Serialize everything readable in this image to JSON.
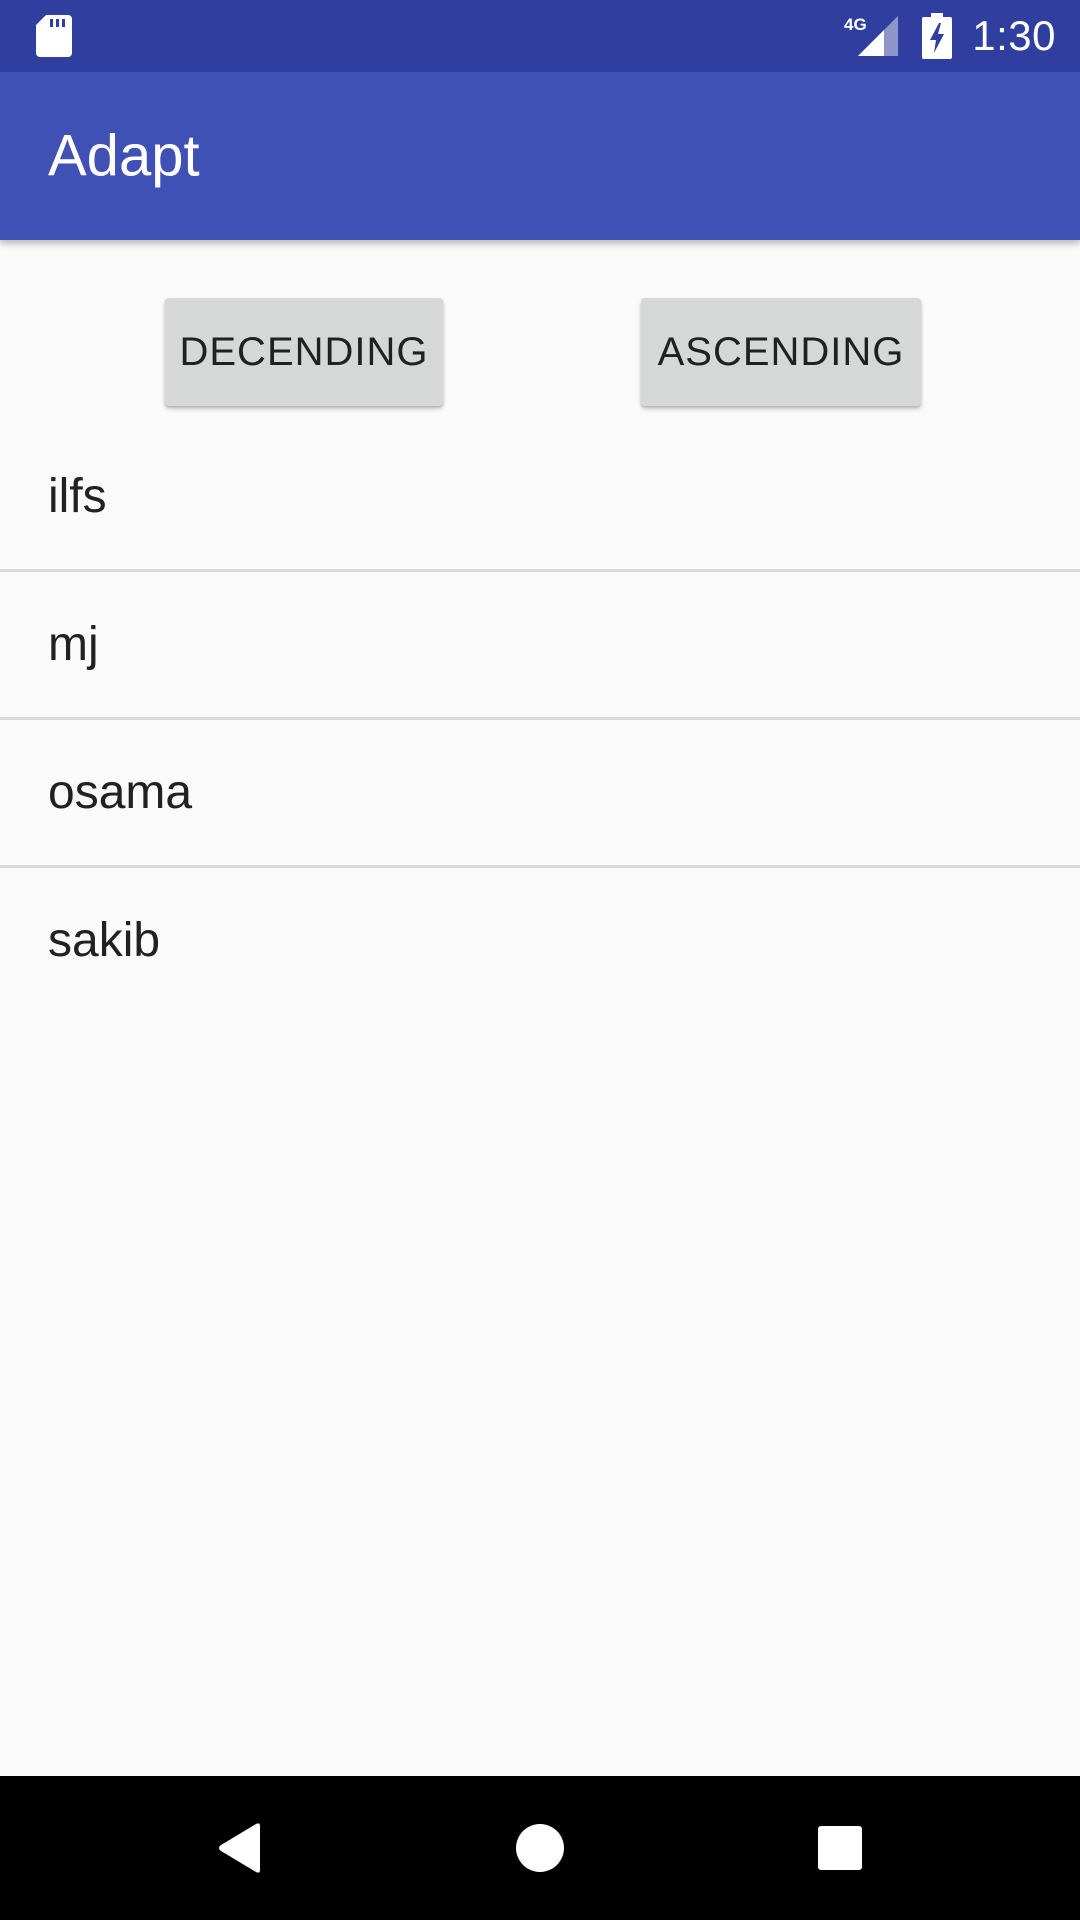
{
  "status_bar": {
    "time": "1:30",
    "network_label": "4G",
    "icons": [
      "sd-card-icon",
      "signal-4g-icon",
      "battery-charging-icon"
    ]
  },
  "app_bar": {
    "title": "Adapt",
    "color": "#3F51B5",
    "status_color": "#303F9F"
  },
  "buttons": {
    "descending_label": "DECENDING",
    "ascending_label": "ASCENDING"
  },
  "list": {
    "items": [
      "ilfs",
      "mj",
      "osama",
      "sakib"
    ]
  },
  "nav_bar": {
    "icons": [
      "back-icon",
      "home-icon",
      "recents-icon"
    ]
  }
}
